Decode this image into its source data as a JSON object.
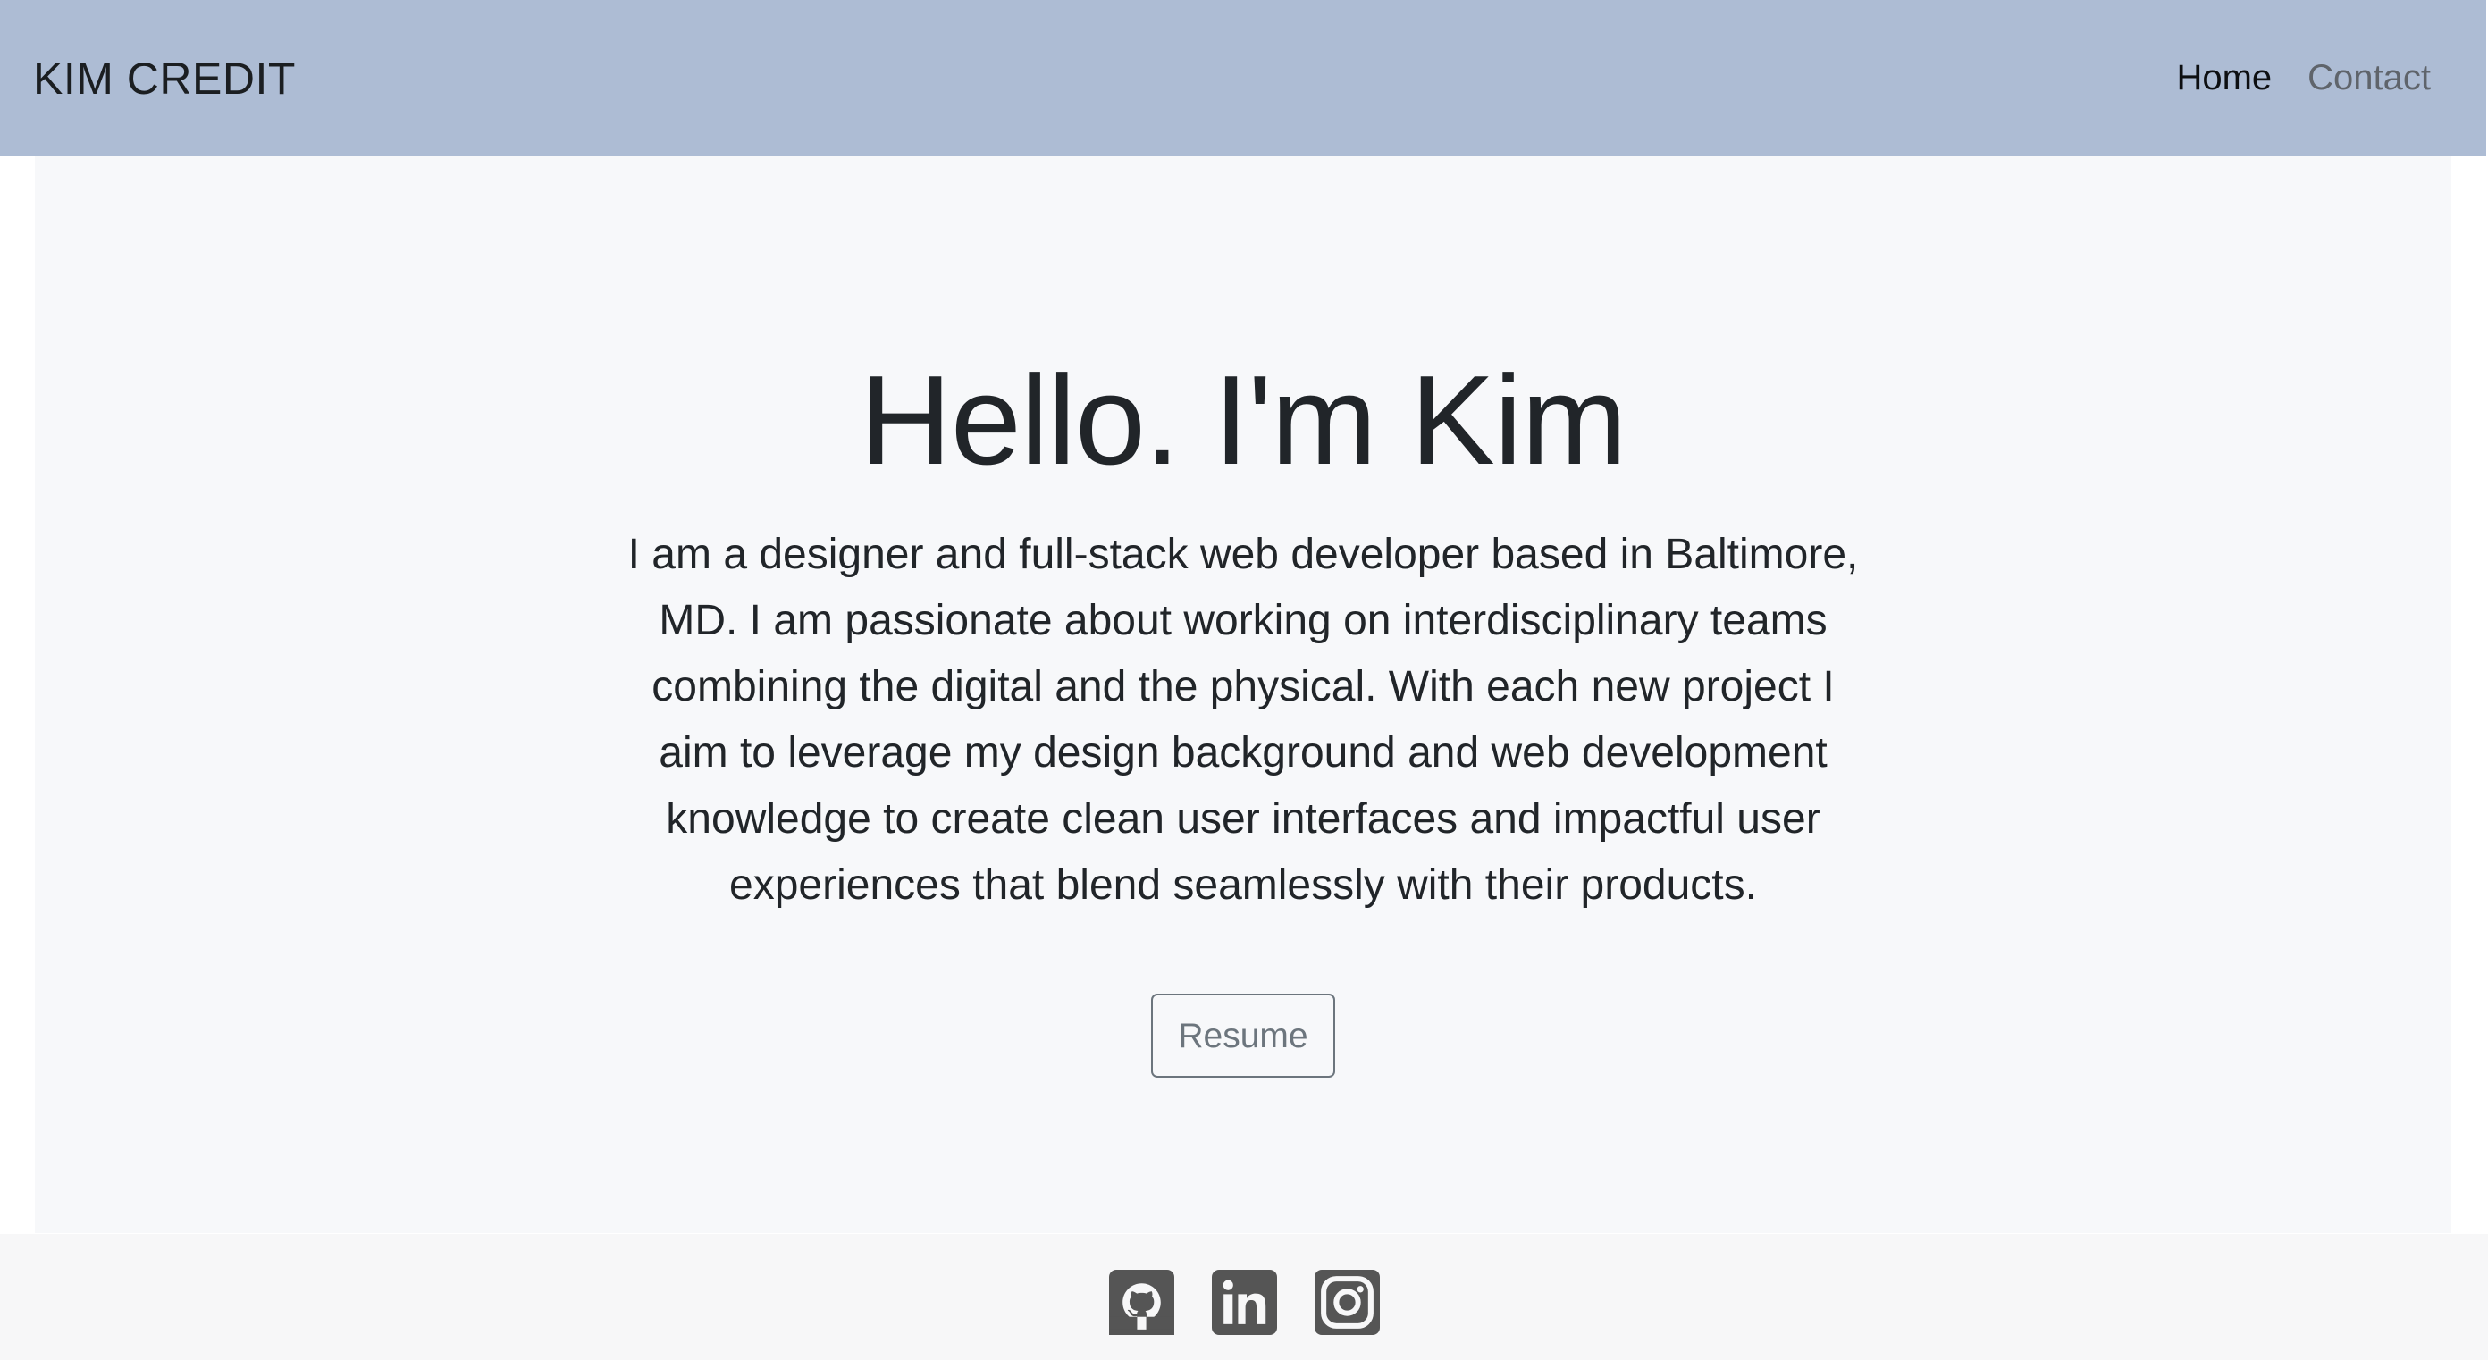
{
  "navbar": {
    "brand": "KIM CREDIT",
    "links": [
      {
        "label": "Home"
      },
      {
        "label": "Contact"
      }
    ]
  },
  "hero": {
    "heading": "Hello. I'm Kim",
    "bio": "I am a designer and full-stack web developer based in Baltimore, MD. I am passionate about working on interdisciplinary teams combining the digital and the physical. With each new project I aim to leverage my design background and web development knowledge to create clean user interfaces and impactful user experiences that blend seamlessly with their products.",
    "resume_label": "Resume"
  },
  "footer": {
    "icons": [
      "github-icon",
      "linkedin-icon",
      "instagram-icon"
    ]
  },
  "colors": {
    "navbar_bg": "#adbcd4",
    "jumbotron_bg": "#f7f8fa",
    "icon_gray": "#555555",
    "button_border": "#6c757d"
  }
}
